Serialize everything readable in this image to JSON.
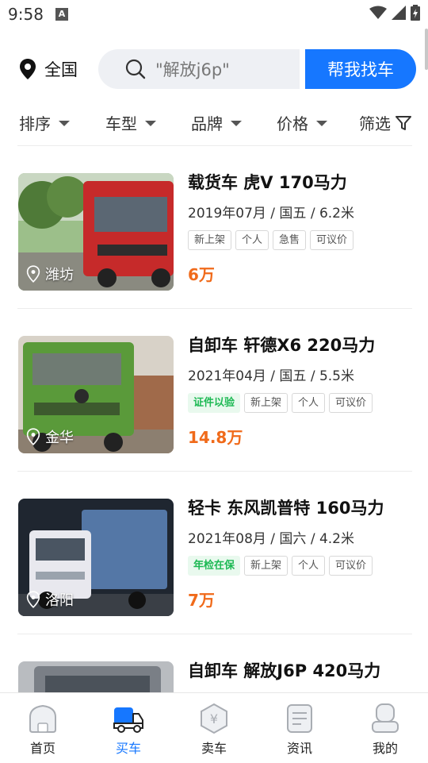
{
  "status": {
    "time": "9:58",
    "notification_glyph": "A"
  },
  "header": {
    "location_label": "全国",
    "search_placeholder": "\"解放j6p\"",
    "find_button": "帮我找车"
  },
  "filters": [
    {
      "label": "排序"
    },
    {
      "label": "车型"
    },
    {
      "label": "品牌"
    },
    {
      "label": "价格"
    },
    {
      "label": "筛选"
    }
  ],
  "listings": [
    {
      "city": "潍坊",
      "title": "载货车 虎V 170马力",
      "meta": "2019年07月 / 国五 / 6.2米",
      "tags": [
        {
          "text": "新上架",
          "style": "plain"
        },
        {
          "text": "个人",
          "style": "plain"
        },
        {
          "text": "急售",
          "style": "plain"
        },
        {
          "text": "可议价",
          "style": "plain"
        }
      ],
      "price": "6万",
      "cab_color": "#c62a2a"
    },
    {
      "city": "金华",
      "title": "自卸车 轩德X6 220马力",
      "meta": "2021年04月 / 国五 / 5.5米",
      "tags": [
        {
          "text": "证件以验",
          "style": "green"
        },
        {
          "text": "新上架",
          "style": "plain"
        },
        {
          "text": "个人",
          "style": "plain"
        },
        {
          "text": "可议价",
          "style": "plain"
        }
      ],
      "price": "14.8万",
      "cab_color": "#5a9a3a"
    },
    {
      "city": "洛阳",
      "title": "轻卡 东风凯普特 160马力",
      "meta": "2021年08月 / 国六 / 4.2米",
      "tags": [
        {
          "text": "年检在保",
          "style": "green"
        },
        {
          "text": "新上架",
          "style": "plain"
        },
        {
          "text": "个人",
          "style": "plain"
        },
        {
          "text": "可议价",
          "style": "plain"
        }
      ],
      "price": "7万",
      "cab_color": "#e8e8ee"
    },
    {
      "city": "",
      "title": "自卸车 解放J6P 420马力",
      "meta": "",
      "tags": [],
      "price": "",
      "cab_color": "#7a7f86"
    }
  ],
  "tabbar": {
    "items": [
      {
        "label": "首页",
        "icon": "home-icon",
        "active": false
      },
      {
        "label": "买车",
        "icon": "truck-icon",
        "active": true
      },
      {
        "label": "卖车",
        "icon": "sell-icon",
        "active": false
      },
      {
        "label": "资讯",
        "icon": "news-icon",
        "active": false
      },
      {
        "label": "我的",
        "icon": "profile-icon",
        "active": false
      }
    ],
    "active_color": "#1677ff"
  },
  "colors": {
    "accent": "#1677ff",
    "price": "#f06a1a",
    "tag_green": "#1db954"
  }
}
